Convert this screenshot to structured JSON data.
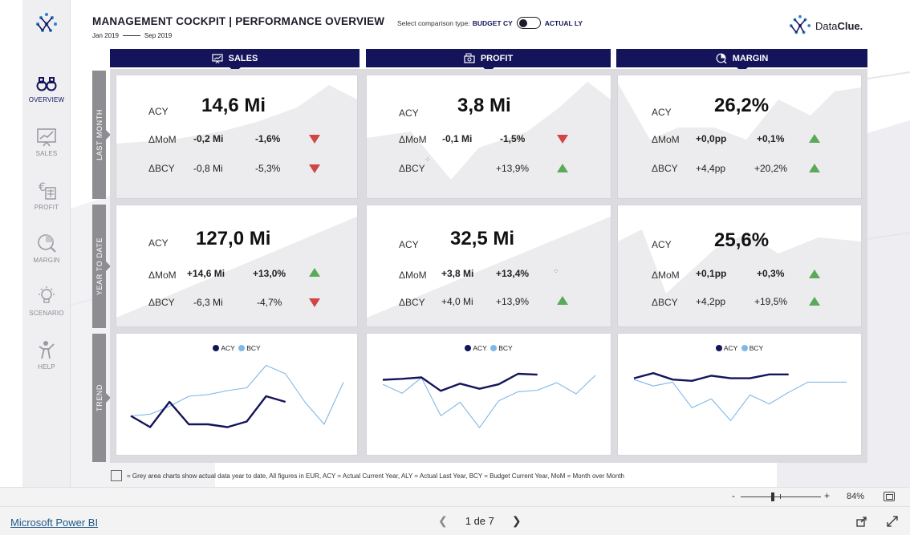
{
  "header": {
    "title": "MANAGEMENT COCKPIT | PERFORMANCE OVERVIEW",
    "date_from": "Jan 2019",
    "date_to": "Sep 2019",
    "comparison_label": "Select comparison type:",
    "comparison_left": "BUDGET CY",
    "comparison_right": "ACTUAL LY",
    "brand_plain": "Data",
    "brand_bold": "Clue."
  },
  "nav": {
    "items": [
      {
        "label": "OVERVIEW",
        "icon": "binoculars-icon",
        "active": true
      },
      {
        "label": "SALES",
        "icon": "chart-board-icon"
      },
      {
        "label": "PROFIT",
        "icon": "euro-calculator-icon"
      },
      {
        "label": "MARGIN",
        "icon": "pie-search-icon"
      },
      {
        "label": "SCENARIO",
        "icon": "lightbulb-icon"
      },
      {
        "label": "HELP",
        "icon": "help-person-icon"
      }
    ]
  },
  "columns": [
    {
      "label": "SALES",
      "icon": "chart-board-icon"
    },
    {
      "label": "PROFIT",
      "icon": "money-stack-icon"
    },
    {
      "label": "MARGIN",
      "icon": "pie-search-icon"
    }
  ],
  "rows": [
    "LAST MONTH",
    "YEAR TO DATE",
    "TREND"
  ],
  "labels": {
    "acy": "ACY",
    "mom": "ΔMoM",
    "bcy": "ΔBCY"
  },
  "kpis": {
    "lm_sales": {
      "big": "14,6 Mi",
      "mom_abs": "-0,2 Mi",
      "mom_pct": "-1,6%",
      "bcy_abs": "-0,8 Mi",
      "bcy_pct": "-5,3%"
    },
    "lm_profit": {
      "big": "3,8 Mi",
      "mom_abs": "-0,1 Mi",
      "mom_pct": "-1,5%",
      "bcy_abs": "",
      "bcy_pct": "+13,9%"
    },
    "lm_margin": {
      "big": "26,2%",
      "mom_abs": "+0,0pp",
      "mom_pct": "+0,1%",
      "bcy_abs": "+4,4pp",
      "bcy_pct": "+20,2%"
    },
    "ytd_sales": {
      "big": "127,0 Mi",
      "mom_abs": "+14,6 Mi",
      "mom_pct": "+13,0%",
      "bcy_abs": "-6,3 Mi",
      "bcy_pct": "-4,7%"
    },
    "ytd_profit": {
      "big": "32,5 Mi",
      "mom_abs": "+3,8 Mi",
      "mom_pct": "+13,4%",
      "bcy_abs": "+4,0 Mi",
      "bcy_pct": "+13,9%"
    },
    "ytd_margin": {
      "big": "25,6%",
      "mom_abs": "+0,1pp",
      "mom_pct": "+0,3%",
      "bcy_abs": "+4,2pp",
      "bcy_pct": "+19,5%"
    }
  },
  "legend": {
    "acy": "ACY",
    "bcy": "BCY"
  },
  "colors": {
    "navy": "#14145a",
    "light_blue": "#7fb8e6",
    "up": "#5aaa5a",
    "down": "#d04545",
    "area": "#ececee",
    "band": "#8e8e92"
  },
  "chart_data": [
    {
      "type": "line",
      "title": "SALES",
      "x": [
        1,
        2,
        3,
        4,
        5,
        6,
        7,
        8,
        9,
        10,
        11,
        12
      ],
      "series": [
        {
          "name": "ACY",
          "values": [
            12.5,
            10.5,
            15.0,
            11.0,
            11.0,
            10.5,
            11.5,
            16.0,
            15.0,
            null,
            null,
            null
          ]
        },
        {
          "name": "BCY",
          "values": [
            12.5,
            12.8,
            14.2,
            16.0,
            16.3,
            17.0,
            17.5,
            21.5,
            20.0,
            15.0,
            11.0,
            18.5
          ]
        }
      ],
      "ylim": [
        8,
        24
      ]
    },
    {
      "type": "line",
      "title": "PROFIT",
      "x": [
        1,
        2,
        3,
        4,
        5,
        6,
        7,
        8,
        9,
        10,
        11,
        12
      ],
      "series": [
        {
          "name": "ACY",
          "values": [
            4.05,
            4.08,
            4.13,
            3.68,
            3.92,
            3.75,
            3.9,
            4.25,
            4.22,
            null,
            null,
            null
          ]
        },
        {
          "name": "BCY",
          "values": [
            3.9,
            3.6,
            4.12,
            2.85,
            3.3,
            2.45,
            3.35,
            3.65,
            3.7,
            3.95,
            3.58,
            4.2
          ]
        }
      ],
      "ylim": [
        2,
        5
      ]
    },
    {
      "type": "line",
      "title": "MARGIN",
      "x": [
        1,
        2,
        3,
        4,
        5,
        6,
        7,
        8,
        9,
        10,
        11,
        12
      ],
      "series": [
        {
          "name": "ACY",
          "values": [
            26.9,
            27.3,
            26.8,
            26.7,
            27.1,
            26.9,
            26.9,
            27.2,
            27.2,
            null,
            null,
            null
          ]
        },
        {
          "name": "BCY",
          "values": [
            26.8,
            26.3,
            26.6,
            24.6,
            25.3,
            23.6,
            25.6,
            24.9,
            25.8,
            26.6,
            26.6,
            26.6
          ]
        }
      ],
      "ylim": [
        22,
        29
      ]
    }
  ],
  "footnote": "= Grey area charts show actual data year to date, All figures in EUR, ACY = Actual Current Year, ALY = Actual Last Year, BCY = Budget Current Year, MoM = Month over Month",
  "zoom": {
    "minus": "-",
    "plus": "+",
    "value": "84%"
  },
  "footer": {
    "link": "Microsoft Power BI",
    "page": "1 de 7"
  }
}
